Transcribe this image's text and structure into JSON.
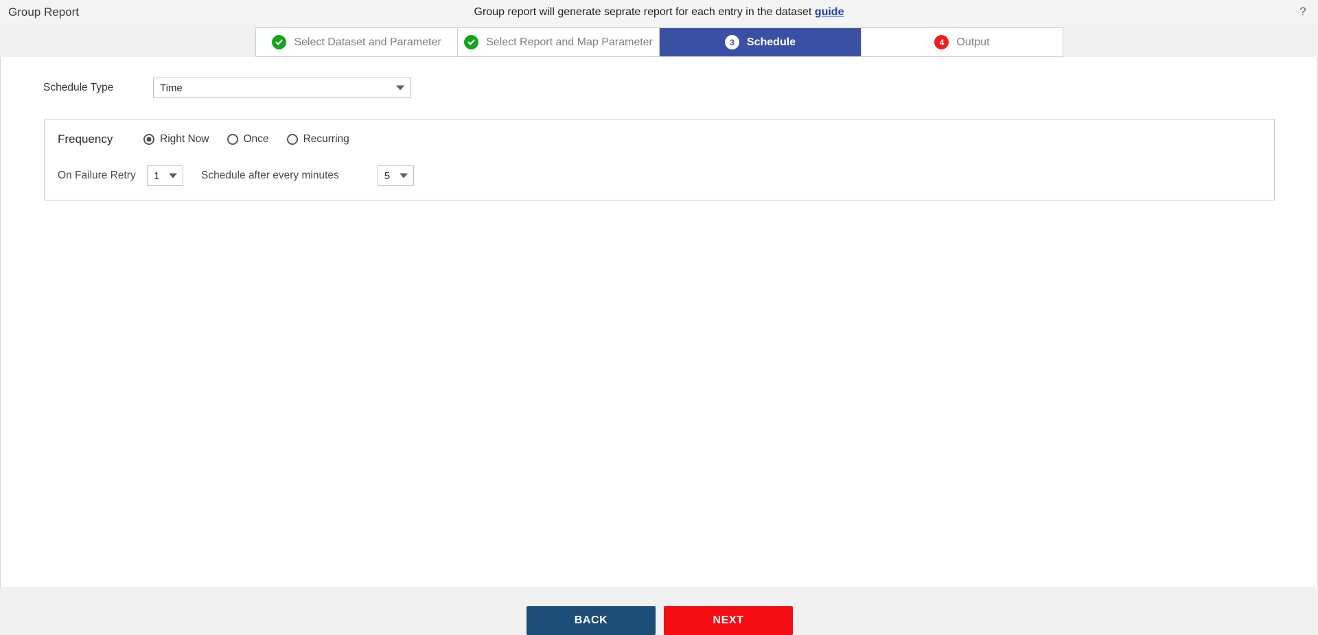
{
  "topbar": {
    "title": "Group Report",
    "banner_text": "Group report will generate seprate report for each entry in the dataset",
    "guide_link": "guide",
    "help_icon": "?"
  },
  "wizard": {
    "tabs": [
      {
        "label": "Select Dataset and Parameter",
        "badge": "✓",
        "state": "complete"
      },
      {
        "label": "Select Report and Map Parameter",
        "badge": "✓",
        "state": "complete"
      },
      {
        "label": "Schedule",
        "badge": "3",
        "state": "active"
      },
      {
        "label": "Output",
        "badge": "4",
        "state": "pending"
      }
    ]
  },
  "form": {
    "schedule_type_label": "Schedule Type",
    "schedule_type_value": "Time",
    "frequency_label": "Frequency",
    "frequency_options": [
      {
        "label": "Right Now",
        "checked": true
      },
      {
        "label": "Once",
        "checked": false
      },
      {
        "label": "Recurring",
        "checked": false
      }
    ],
    "retry_label": "On Failure Retry",
    "retry_value": "1",
    "minutes_label": "Schedule after every minutes",
    "minutes_value": "5"
  },
  "footer": {
    "back_label": "BACK",
    "next_label": "NEXT"
  },
  "colors": {
    "active_tab": "#3a51a3",
    "check_green": "#15a31b",
    "badge_red": "#f01c20",
    "back_button": "#1d4e79",
    "next_button": "#f60d14",
    "link_blue": "#1a3fb5"
  }
}
